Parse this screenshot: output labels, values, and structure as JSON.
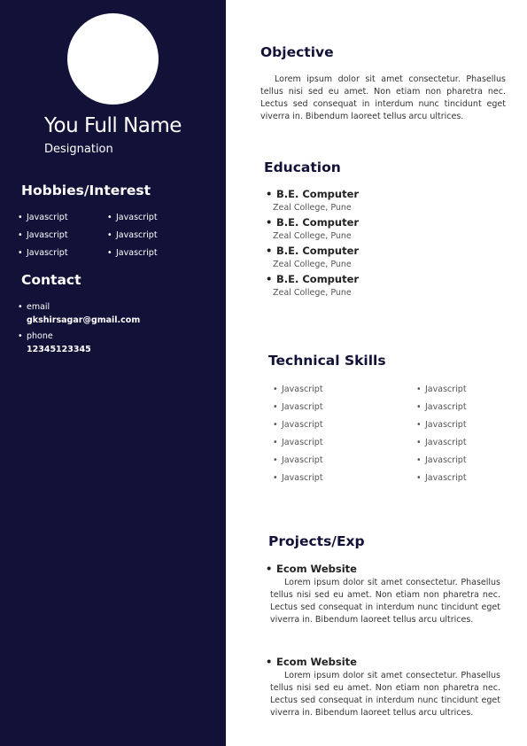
{
  "sidebar": {
    "name": "You Full Name",
    "designation": "Designation",
    "hobbies_heading": "Hobbies/Interest",
    "hobbies": [
      "Javascript",
      "Javascript",
      "Javascript",
      "Javascript",
      "Javascript",
      "Javascript"
    ],
    "contact_heading": "Contact",
    "contact": {
      "email_label": "email",
      "email_value": "gkshirsagar@gmail.com",
      "phone_label": "phone",
      "phone_value": "12345123345"
    }
  },
  "objective": {
    "heading": "Objective",
    "text": "Lorem ipsum dolor sit amet consectetur. Phasellus tellus nisi sed eu amet. Non etiam non pharetra nec. Lectus sed consequat in interdum nunc tincidunt eget viverra in. Bibendum laoreet tellus arcu ultrices."
  },
  "education": {
    "heading": "Education",
    "items": [
      {
        "degree": "B.E. Computer",
        "college": "Zeal College, Pune"
      },
      {
        "degree": "B.E. Computer",
        "college": "Zeal College, Pune"
      },
      {
        "degree": "B.E. Computer",
        "college": "Zeal College, Pune"
      },
      {
        "degree": "B.E. Computer",
        "college": "Zeal College, Pune"
      }
    ]
  },
  "skills": {
    "heading": "Technical Skills",
    "items": [
      "Javascript",
      "Javascript",
      "Javascript",
      "Javascript",
      "Javascript",
      "Javascript",
      "Javascript",
      "Javascript",
      "Javascript",
      "Javascript",
      "Javascript",
      "Javascript"
    ]
  },
  "projects": {
    "heading": "Projects/Exp",
    "items": [
      {
        "title": "Ecom Website",
        "description": "Lorem ipsum dolor sit amet consectetur. Phasellus tellus nisi sed eu amet. Non etiam non pharetra nec. Lectus sed consequat in interdum nunc tincidunt eget viverra in. Bibendum laoreet tellus arcu ultrices."
      },
      {
        "title": "Ecom Website",
        "description": "Lorem ipsum dolor sit amet consectetur. Phasellus tellus nisi sed eu amet. Non etiam non pharetra nec. Lectus sed consequat in interdum nunc tincidunt eget viverra in. Bibendum laoreet tellus arcu ultrices."
      }
    ]
  },
  "colors": {
    "sidebar_bg": "#121138",
    "heading_color": "#121138"
  }
}
